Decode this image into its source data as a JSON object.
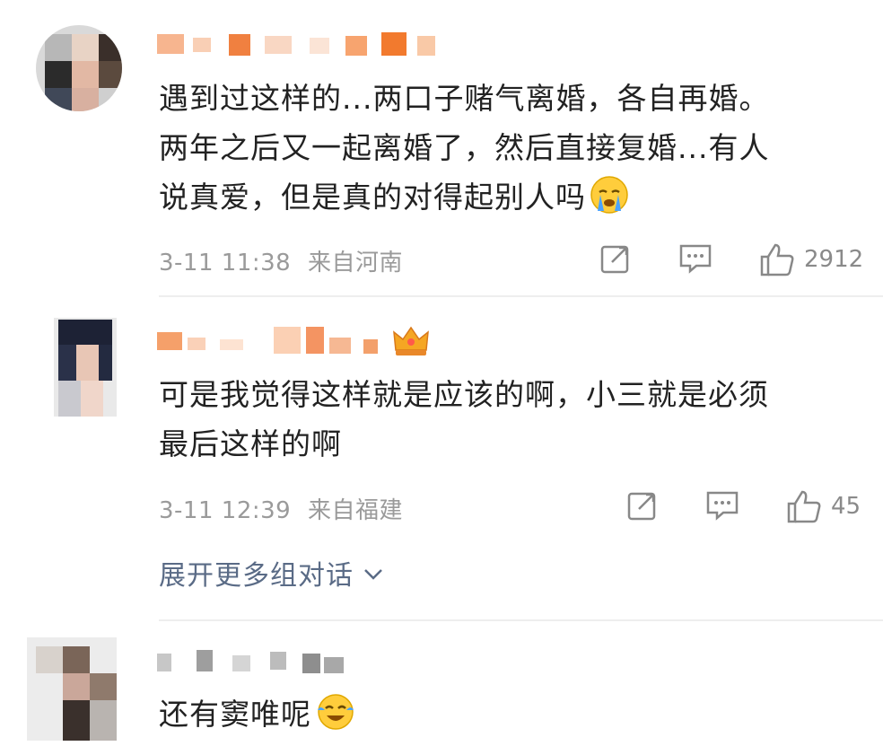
{
  "comments": [
    {
      "text_lines": [
        "遇到过这样的...两口子赌气离婚，各自再婚。",
        "两年之后又一起离婚了，然后直接复婚...有人",
        "说真爱，但是真的对得起别人吗"
      ],
      "emoji": "crying-face",
      "timestamp": "3-11 11:38",
      "location": "来自河南",
      "likes": "2912"
    },
    {
      "text_lines": [
        "可是我觉得这样就是应该的啊，小三就是必须",
        "最后这样的啊"
      ],
      "timestamp": "3-11 12:39",
      "location": "来自福建",
      "likes": "45",
      "badge": "crown-badge"
    },
    {
      "text_lines": [
        "还有窦唯呢"
      ],
      "emoji": "laughing-tears-face"
    }
  ],
  "expand_label": "展开更多组对话",
  "colors": {
    "link": "#5a6b86",
    "meta": "#9a9a9a",
    "divider": "#eeeeee",
    "badge": "#f5a623"
  }
}
